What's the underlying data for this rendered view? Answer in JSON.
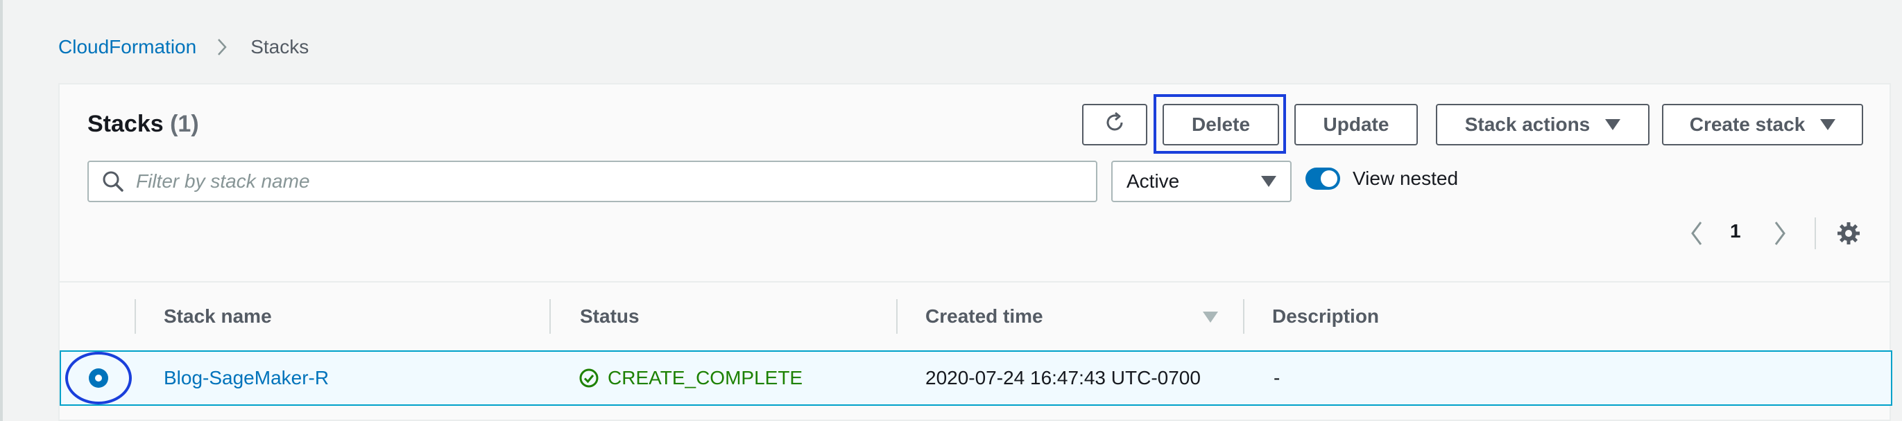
{
  "breadcrumb": {
    "root": "CloudFormation",
    "current": "Stacks"
  },
  "panel": {
    "title": "Stacks",
    "count": "(1)"
  },
  "toolbar": {
    "refresh_icon": "refresh-icon",
    "delete_label": "Delete",
    "update_label": "Update",
    "stack_actions_label": "Stack actions",
    "create_stack_label": "Create stack"
  },
  "filter": {
    "placeholder": "Filter by stack name",
    "status_selected": "Active",
    "view_nested_label": "View nested",
    "view_nested_on": true
  },
  "pagination": {
    "current_page": "1"
  },
  "table": {
    "columns": [
      "Stack name",
      "Status",
      "Created time",
      "Description"
    ],
    "sorted_column": "Created time",
    "sort_direction": "descending",
    "rows": [
      {
        "selected": true,
        "stack_name": "Blog-SageMaker-R",
        "status": "CREATE_COMPLETE",
        "created_time": "2020-07-24 16:47:43 UTC-0700",
        "description": "-"
      }
    ]
  },
  "colors": {
    "link": "#0073bb",
    "success": "#1d8102",
    "annotation": "#1a3fdb",
    "selected_row_border": "#00a1c9",
    "selected_row_bg": "#f1faff"
  }
}
